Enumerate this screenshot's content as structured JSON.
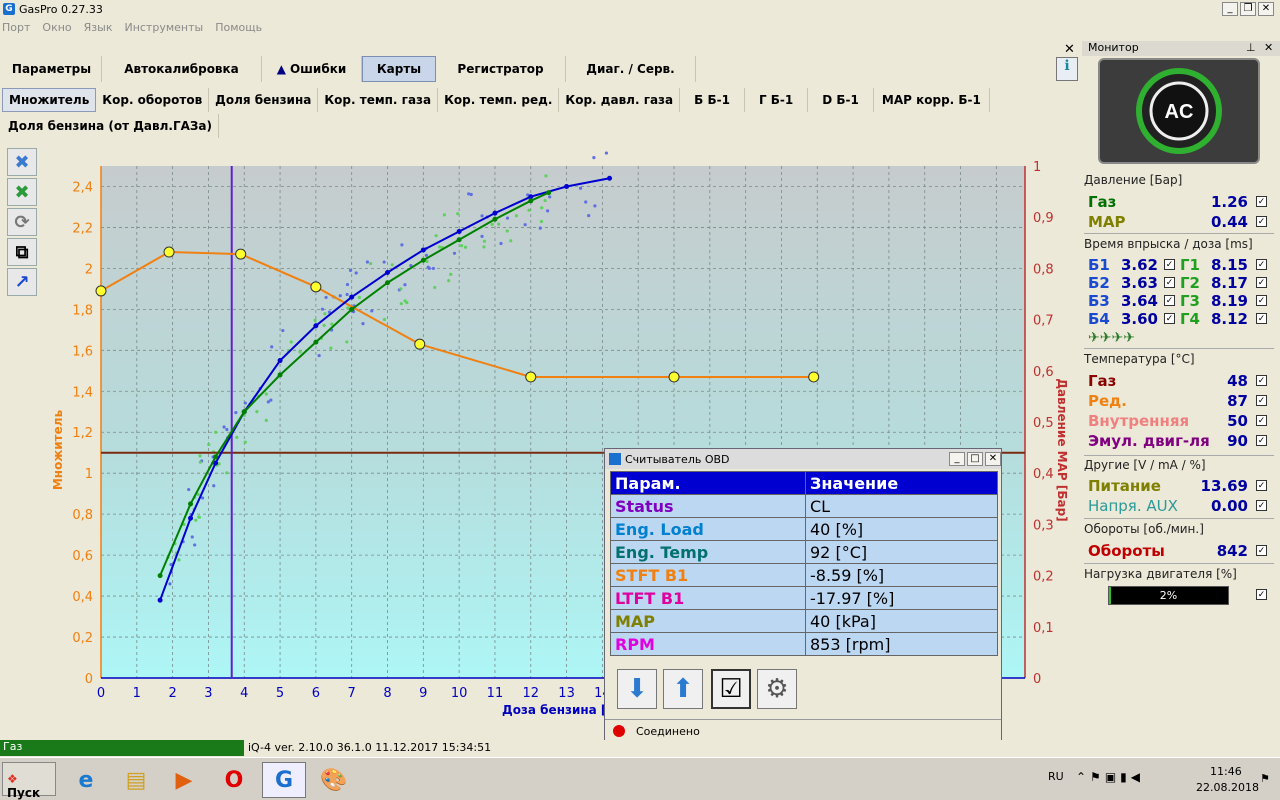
{
  "window": {
    "title": "GasPro 0.27.33"
  },
  "menu": [
    "Порт",
    "Окно",
    "Язык",
    "Инструменты",
    "Помощь"
  ],
  "main_tabs": [
    {
      "label": "Параметры"
    },
    {
      "label": "Автокалибровка"
    },
    {
      "label": "Ошибки"
    },
    {
      "label": "Карты"
    },
    {
      "label": "Регистратор"
    },
    {
      "label": "Диаг. / Серв."
    }
  ],
  "sub_tabs": [
    {
      "label": "Множитель"
    },
    {
      "label": "Кор. оборотов"
    },
    {
      "label": "Доля бензина"
    },
    {
      "label": "Кор. темп. газа"
    },
    {
      "label": "Кор. темп. ред."
    },
    {
      "label": "Кор. давл. газа"
    },
    {
      "label": "Б Б-1"
    },
    {
      "label": "Г Б-1"
    },
    {
      "label": "D Б-1"
    },
    {
      "label": "MAP корр. Б-1"
    }
  ],
  "sub_tab2": {
    "label": "Доля бензина (от Давл.ГАЗа)"
  },
  "chart_data": {
    "type": "line",
    "ylabel": "Множитель",
    "y2label": "Давление MAP [Бар]",
    "xlabel": "Доза бензина [мс",
    "xticks": [
      "0",
      "1",
      "2",
      "3",
      "4",
      "5",
      "6",
      "7",
      "8",
      "9",
      "10",
      "11",
      "12",
      "13",
      "14"
    ],
    "yticks": [
      "0",
      "0,2",
      "0,4",
      "0,6",
      "0,8",
      "1",
      "1,2",
      "1,4",
      "1,6",
      "1,8",
      "2",
      "2,2",
      "2,4"
    ],
    "y2ticks": [
      "0",
      "0,1",
      "0,2",
      "0,3",
      "0,4",
      "0,5",
      "0,6",
      "0,7",
      "0,8",
      "0,9",
      "1"
    ],
    "xlim": [
      0,
      14.5
    ],
    "ylim": [
      0,
      2.5
    ],
    "series": [
      {
        "values": [
          [
            0,
            1.89
          ],
          [
            1.9,
            2.08
          ],
          [
            3.9,
            2.07
          ],
          [
            6,
            1.91
          ],
          [
            8.9,
            1.63
          ],
          [
            12,
            1.47
          ],
          [
            16,
            1.47
          ],
          [
            19.9,
            1.47
          ]
        ],
        "color": "#f08010"
      },
      {
        "values": [
          [
            1.65,
            0.38
          ],
          [
            2.5,
            0.78
          ],
          [
            3.2,
            1.05
          ],
          [
            4,
            1.3
          ],
          [
            5,
            1.55
          ],
          [
            6,
            1.72
          ],
          [
            7,
            1.86
          ],
          [
            8,
            1.98
          ],
          [
            9,
            2.09
          ],
          [
            10,
            2.18
          ],
          [
            11,
            2.27
          ],
          [
            12,
            2.35
          ],
          [
            13,
            2.4
          ],
          [
            14.2,
            2.44
          ]
        ],
        "color": "#0000d0"
      },
      {
        "values": [
          [
            1.65,
            0.5
          ],
          [
            2.5,
            0.85
          ],
          [
            3.2,
            1.08
          ],
          [
            4,
            1.3
          ],
          [
            5,
            1.48
          ],
          [
            6,
            1.64
          ],
          [
            7,
            1.8
          ],
          [
            8,
            1.93
          ],
          [
            9,
            2.04
          ],
          [
            10,
            2.14
          ],
          [
            11,
            2.24
          ],
          [
            12,
            2.33
          ],
          [
            12.5,
            2.37
          ]
        ],
        "color": "#008000"
      }
    ],
    "cursor_x": 3.65,
    "hline_y": 1.1
  },
  "monitor": {
    "title": "Монитор",
    "pressure_title": "Давление [Бар]",
    "gas_label": "Газ",
    "gas_val": "1.26",
    "map_label": "MAP",
    "map_val": "0.44",
    "inj_title": "Время впрыска / доза [ms]",
    "inj": [
      {
        "b": "Б1",
        "bv": "3.62",
        "g": "Г1",
        "gv": "8.15"
      },
      {
        "b": "Б2",
        "bv": "3.63",
        "g": "Г2",
        "gv": "8.17"
      },
      {
        "b": "Б3",
        "bv": "3.64",
        "g": "Г3",
        "gv": "8.19"
      },
      {
        "b": "Б4",
        "bv": "3.60",
        "g": "Г4",
        "gv": "8.12"
      }
    ],
    "temp_title": "Температура [°C]",
    "temps": [
      {
        "label": "Газ",
        "val": "48",
        "color": "#8b0000"
      },
      {
        "label": "Ред.",
        "val": "87",
        "color": "#f08010"
      },
      {
        "label": "Внутренняя",
        "val": "50",
        "color": "#f08080"
      },
      {
        "label": "Эмул. двиг-ля",
        "val": "90",
        "color": "#800080"
      }
    ],
    "other_title": "Другие [V / mA / %]",
    "power_label": "Питание",
    "power_val": "13.69",
    "aux_label": "Напря. AUX",
    "aux_val": "0.00",
    "rpm_title": "Обороты [об./мин.]",
    "rpm_label": "Обороты",
    "rpm_val": "842",
    "load_title": "Нагрузка двигателя [%]",
    "load_val": "2%",
    "load_fraction": 0.02
  },
  "obd": {
    "title": "Считыватель OBD",
    "col1": "Парам.",
    "col2": "Значение",
    "rows": [
      {
        "p": "Status",
        "v": "CL",
        "color": "#8000c0"
      },
      {
        "p": "Eng. Load",
        "v": "40 [%]",
        "color": "#0080d0"
      },
      {
        "p": "Eng. Temp",
        "v": "92 [°C]",
        "color": "#007070"
      },
      {
        "p": "STFT B1",
        "v": "-8.59 [%]",
        "color": "#f08010"
      },
      {
        "p": "LTFT B1",
        "v": "-17.97 [%]",
        "color": "#e000a0"
      },
      {
        "p": "MAP",
        "v": "40 [kPa]",
        "color": "#808000"
      },
      {
        "p": "RPM",
        "v": "853 [rpm]",
        "color": "#e000e0"
      }
    ],
    "status_text": "Соединено"
  },
  "statusbar": {
    "mode": "Газ",
    "info": "iQ-4  ver. 2.10.0  36.1.0  11.12.2017 15:34:51"
  },
  "taskbar": {
    "start": "Пуск",
    "lang": "RU",
    "time": "11:46",
    "date": "22.08.2018"
  }
}
